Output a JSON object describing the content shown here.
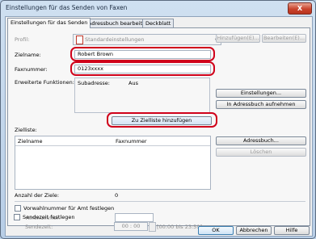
{
  "window": {
    "title": "Einstellungen für das Senden von Faxen",
    "close_symbol": "X"
  },
  "tabs": [
    {
      "label": "Einstellungen für das Senden"
    },
    {
      "label": "Adressbuch bearbeiten"
    },
    {
      "label": "Deckblatt"
    }
  ],
  "profile": {
    "label": "Profil:",
    "value": "Standardeinstellungen",
    "btn_register": "Hinzufügen(E)...",
    "btn_edit": "Bearbeiten(E)..."
  },
  "recipient": {
    "name_label": "Zielname:",
    "name_value": "Robert Brown",
    "fax_label": "Faxnummer:",
    "fax_value": "0123xxxx"
  },
  "extended": {
    "label": "Erweiterte Funktionen:",
    "subaddress_label": "Subadresse:",
    "subaddress_value": "Aus",
    "btn_settings": "Einstellungen...",
    "btn_add_addressbook": "In Adressbuch aufnehmen"
  },
  "add_to_list_button": "Zu Zielliste hinzufügen",
  "targets": {
    "label": "Zielliste:",
    "col_name": "Zielname",
    "col_fax": "Faxnummer",
    "btn_addressbook": "Adressbuch...",
    "btn_delete": "Löschen",
    "count_label": "Anzahl der Ziele:",
    "count_value": "0"
  },
  "prefix": {
    "label": "Vorwahlnummer für Amt festlegen",
    "sub_label": "Amtnummer:"
  },
  "sendtime": {
    "label": "Sendezeit festlegen",
    "sub_label": "Sendezeit:",
    "value": "00 : 00",
    "range": "[00:00 bis 23:59]"
  },
  "footer": {
    "ok": "OK",
    "cancel": "Abbrechen",
    "help": "Hilfe"
  }
}
